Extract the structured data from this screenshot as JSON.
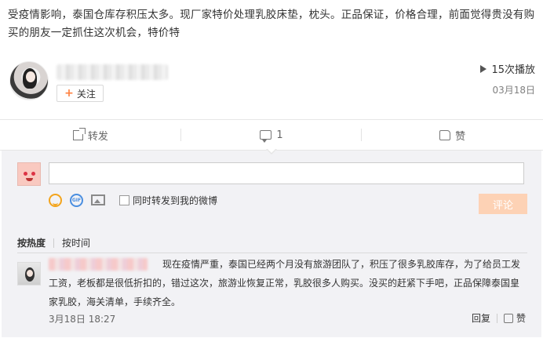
{
  "post": {
    "text": "受疫情影响，泰国仓库存积压太多。现厂家特价处理乳胶床垫，枕头。正品保证，价格合理，前面觉得贵没有购买的朋友一定抓住这次机会，特价特",
    "follow_label": "关注",
    "plays": "15次播放",
    "date": "03月18日"
  },
  "actions": {
    "repost": "转发",
    "comment_count": "1",
    "like": "赞"
  },
  "composer": {
    "input_value": "",
    "repost_option": "同时转发到我的微博",
    "submit": "评论"
  },
  "sort": {
    "hot": "按热度",
    "time": "按时间"
  },
  "comment": {
    "text": "现在疫情严重，泰国已经两个月没有旅游团队了，积压了很多乳胶库存，为了给员工发工资，老板都是很低折扣的，错过这次，旅游业恢复正常，乳胶很多人购买。没买的赶紧下手吧，正品保障泰国皇家乳胶，海关清单，手续齐全。",
    "time": "3月18日 18:27",
    "reply": "回复",
    "like": "赞"
  },
  "colors": {
    "accent_orange": "#ff8140",
    "submit_bg": "#fdd2b5",
    "comment_bg": "#f2f2f5"
  }
}
